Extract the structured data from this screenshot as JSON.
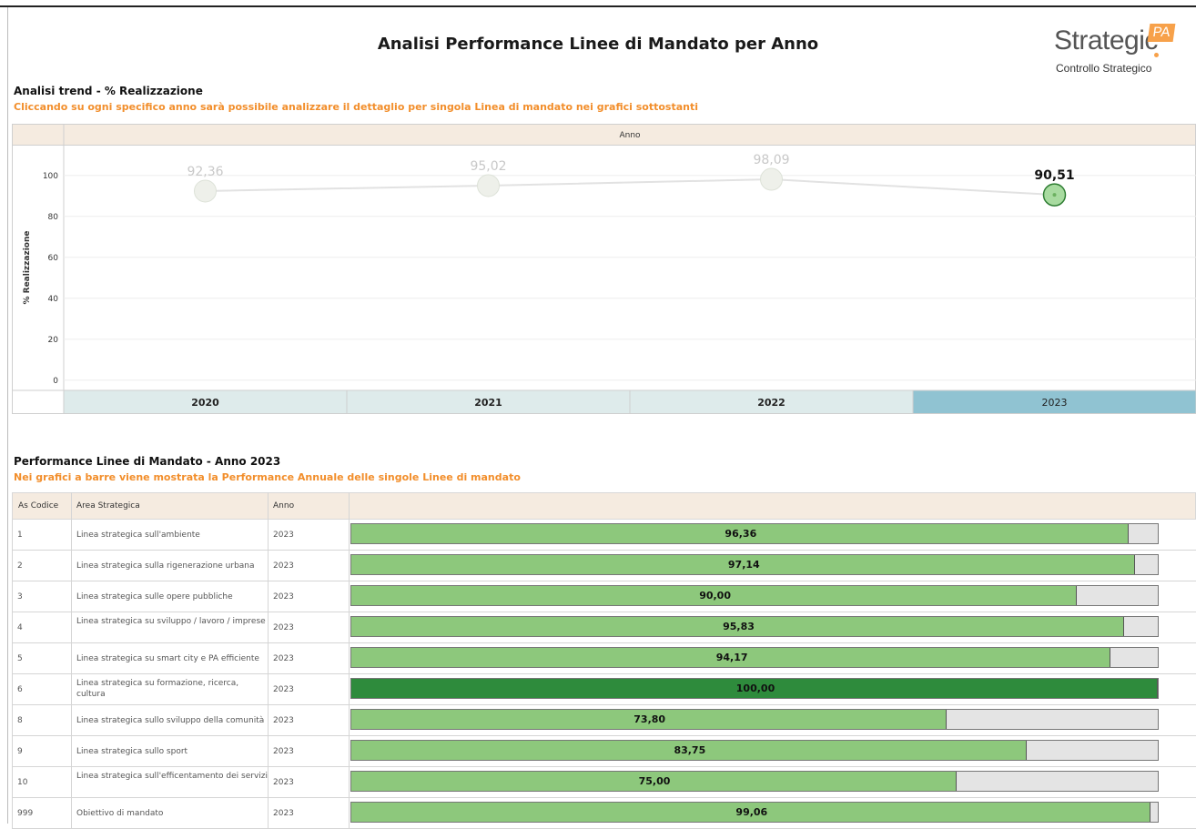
{
  "page": {
    "title": "Analisi Performance Linee di Mandato per Anno"
  },
  "logo": {
    "word": "Strategic",
    "badge": "PA",
    "subtitle": "Controllo Strategico"
  },
  "trend_section": {
    "title": "Analisi trend - % Realizzazione",
    "subtitle": "Cliccando su ogni specifico anno sarà possibile analizzare il dettaglio per singola Linea di mandato nei grafici sottostanti",
    "header_label": "Anno",
    "selected_year": "2023"
  },
  "bars_section": {
    "title": "Performance Linee di Mandato - Anno 2023",
    "subtitle": "Nei grafici a barre viene mostrata la Performance Annuale delle singole Linee di mandato",
    "columns": [
      "As Codice",
      "Area Strategica",
      "Anno"
    ]
  },
  "colors": {
    "accent_orange": "#f28e2b",
    "bar_green": "#8dc87c",
    "bar_full_green": "#2e8b3c",
    "header_beige": "#f5ebe0",
    "selected_year_bg": "#90c3d2",
    "year_bg": "#deebeb"
  },
  "chart_data": [
    {
      "type": "line",
      "x": [
        "2020",
        "2021",
        "2022",
        "2023"
      ],
      "values": [
        92.36,
        95.02,
        98.09,
        90.51
      ],
      "value_labels": [
        "92,36",
        "95,02",
        "98,09",
        "90,51"
      ],
      "ylabel": "% Realizzazione",
      "yticks": [
        0,
        20,
        40,
        60,
        80,
        100
      ],
      "ylim": [
        -5,
        115
      ],
      "grid": true,
      "highlighted": "2023"
    },
    {
      "type": "bar",
      "orientation": "horizontal",
      "rows": [
        {
          "code": "1",
          "area": "Linea strategica sull'ambiente",
          "year": "2023",
          "value": 96.36,
          "label": "96,36"
        },
        {
          "code": "2",
          "area": "Linea strategica sulla rigenerazione urbana",
          "year": "2023",
          "value": 97.14,
          "label": "97,14"
        },
        {
          "code": "3",
          "area": "Linea strategica sulle opere pubbliche",
          "year": "2023",
          "value": 90.0,
          "label": "90,00"
        },
        {
          "code": "4",
          "area": "Linea strategica su sviluppo / lavoro / imprese",
          "year": "2023",
          "value": 95.83,
          "label": "95,83"
        },
        {
          "code": "5",
          "area": "Linea strategica su smart city e PA efficiente",
          "year": "2023",
          "value": 94.17,
          "label": "94,17"
        },
        {
          "code": "6",
          "area": "Linea strategica su formazione, ricerca, cultura",
          "year": "2023",
          "value": 100.0,
          "label": "100,00"
        },
        {
          "code": "8",
          "area": "Linea strategica sullo sviluppo della comunità",
          "year": "2023",
          "value": 73.8,
          "label": "73,80"
        },
        {
          "code": "9",
          "area": "Linea strategica sullo sport",
          "year": "2023",
          "value": 83.75,
          "label": "83,75"
        },
        {
          "code": "10",
          "area": "Linea strategica sull'efficentamento dei servizi",
          "year": "2023",
          "value": 75.0,
          "label": "75,00"
        },
        {
          "code": "999",
          "area": "Obiettivo di mandato",
          "year": "2023",
          "value": 99.06,
          "label": "99,06"
        }
      ],
      "xlim": [
        0,
        100
      ]
    }
  ]
}
